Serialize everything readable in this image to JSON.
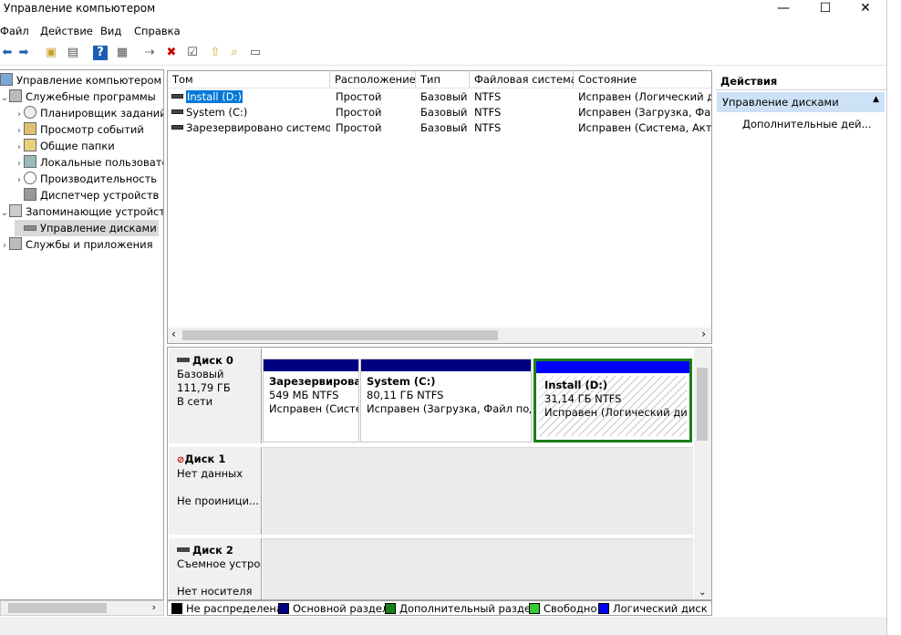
{
  "window": {
    "title": "Управление компьютером",
    "minimize": "—",
    "maximize": "☐",
    "close": "✕"
  },
  "menu": [
    "Файл",
    "Действие",
    "Вид",
    "Справка"
  ],
  "toolbar_icons": [
    "back-arrow-icon",
    "forward-arrow-icon",
    "up-folder-icon",
    "show-hide-tree-icon",
    "help-icon",
    "console-icon",
    "connect-icon",
    "delete-icon",
    "properties-icon",
    "export-icon",
    "find-icon",
    "settings-icon"
  ],
  "tree": [
    {
      "label": "Управление компьютером (л",
      "indent": 0,
      "expand": ""
    },
    {
      "label": "Служебные программы",
      "indent": 1,
      "expand": "⌄"
    },
    {
      "label": "Планировщик заданий",
      "indent": 2,
      "expand": "›"
    },
    {
      "label": "Просмотр событий",
      "indent": 2,
      "expand": "›"
    },
    {
      "label": "Общие папки",
      "indent": 2,
      "expand": "›"
    },
    {
      "label": "Локальные пользовате",
      "indent": 2,
      "expand": "›"
    },
    {
      "label": "Производительность",
      "indent": 2,
      "expand": "›"
    },
    {
      "label": "Диспетчер устройств",
      "indent": 2,
      "expand": ""
    },
    {
      "label": "Запоминающие устройст",
      "indent": 1,
      "expand": "⌄"
    },
    {
      "label": "Управление дисками",
      "indent": 2,
      "expand": ""
    },
    {
      "label": "Службы и приложения",
      "indent": 1,
      "expand": "›"
    }
  ],
  "volumes": {
    "headers": [
      "Том",
      "Расположение",
      "Тип",
      "Файловая система",
      "Состояние"
    ],
    "rows": [
      [
        "Install (D:)",
        "Простой",
        "Базовый",
        "NTFS",
        "Исправен (Логический ди"
      ],
      [
        "System (C:)",
        "Простой",
        "Базовый",
        "NTFS",
        "Исправен (Загрузка, Файл"
      ],
      [
        "Зарезервировано системой",
        "Простой",
        "Базовый",
        "NTFS",
        "Исправен (Система, Актив"
      ]
    ]
  },
  "disks": [
    {
      "name": "Диск 0",
      "type": "Базовый",
      "size": "111,79 ГБ",
      "status": "В сети",
      "partitions": [
        {
          "name": "Зарезервирова",
          "size": "549 МБ NTFS",
          "status": "Исправен (Систе"
        },
        {
          "name": "System  (C:)",
          "size": "80,11 ГБ NTFS",
          "status": "Исправен (Загрузка, Файл подк"
        },
        {
          "name": "Install  (D:)",
          "size": "31,14 ГБ NTFS",
          "status": "Исправен (Логический диск"
        }
      ]
    },
    {
      "name": "Диск 1",
      "type": "Нет данных",
      "size": "",
      "status": "Не проиници..."
    },
    {
      "name": "Диск 2",
      "type": "Съемное устро",
      "size": "",
      "status": "Нет носителя"
    }
  ],
  "legend": [
    {
      "label": "Не распределена",
      "color": "#000000"
    },
    {
      "label": "Основной раздел",
      "color": "#000080"
    },
    {
      "label": "Дополнительный раздел",
      "color": "#1a7f1a"
    },
    {
      "label": "Свободно",
      "color": "#33cc33"
    },
    {
      "label": "Логический диск",
      "color": "#0000ff"
    }
  ],
  "actions": {
    "title": "Действия",
    "section": "Управление дисками",
    "more": "Дополнительные дей..."
  }
}
